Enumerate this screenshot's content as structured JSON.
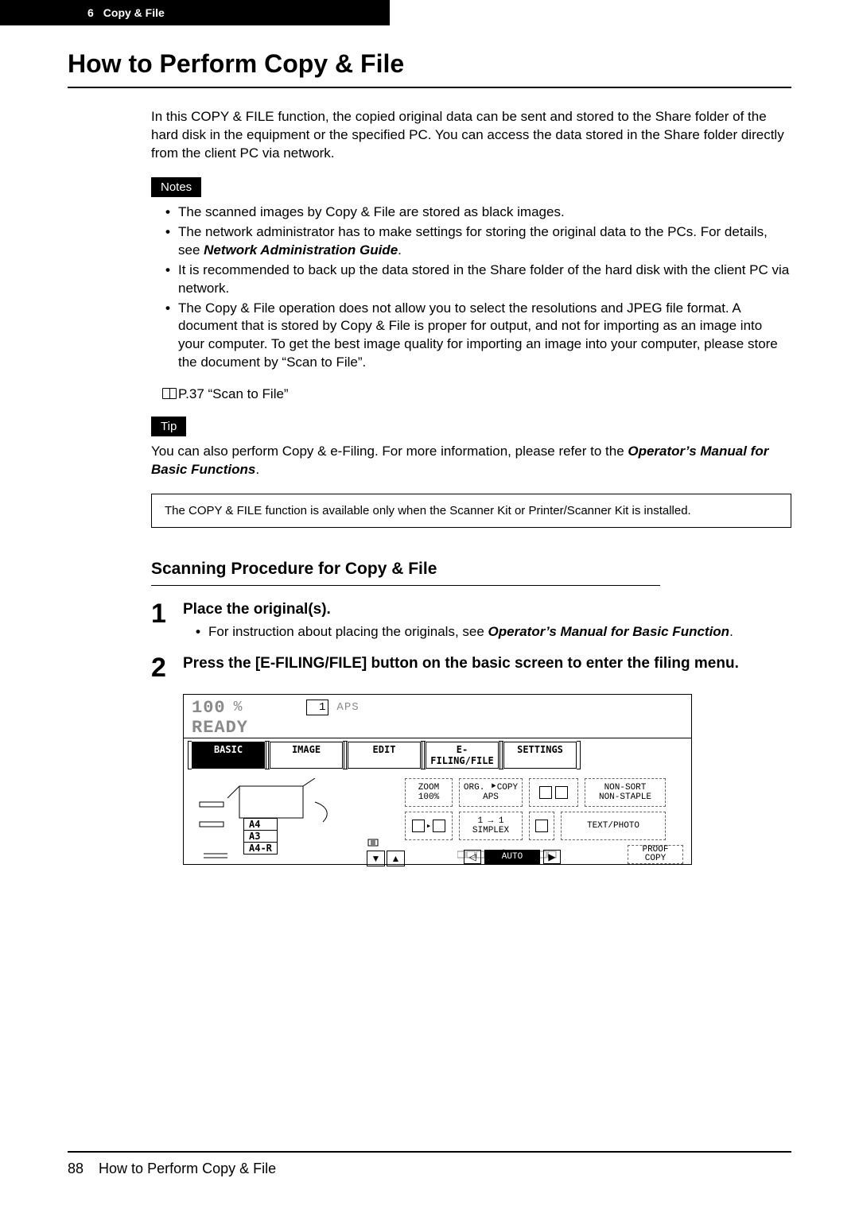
{
  "header": {
    "chapter_num": "6",
    "chapter_title": "Copy & File"
  },
  "main_title": "How to Perform Copy & File",
  "intro": "In this COPY & FILE function, the copied original data can be sent and stored to the Share folder of the hard disk in the equipment or the specified PC. You can access the data stored in the Share folder directly from the client PC via network.",
  "notes_label": "Notes",
  "notes": [
    "The scanned images by Copy & File are stored as black images.",
    "The network administrator has to make settings for storing the original data to the PCs. For details, see ",
    "It is recommended to back up the data stored in the Share folder of the hard disk with the client PC via network.",
    "The Copy & File operation does not allow you to select the resolutions and JPEG file format. A document that is stored by Copy & File is proper for output, and not for importing as an image into your computer.  To get the best image quality for importing an image into your computer, please store the document by “Scan to File”."
  ],
  "notes_bold_ref": "Network Administration Guide",
  "notes_ref_line": "P.37 “Scan to File”",
  "tip_label": "Tip",
  "tip_text_pre": "You can also perform Copy & e-Filing.  For more information, please refer to the ",
  "tip_bold": "Operator’s Manual for Basic Functions",
  "tip_text_post": ".",
  "box_note": "The COPY & FILE function is available only when the Scanner Kit or Printer/Scanner Kit is installed.",
  "proc_title": "Scanning Procedure for Copy & File",
  "steps": {
    "s1_num": "1",
    "s1_title": "Place the original(s).",
    "s1_sub_pre": "For instruction about placing the originals, see ",
    "s1_sub_bold": "Operator’s Manual for Basic Function",
    "s1_sub_post": ".",
    "s2_num": "2",
    "s2_title": "Press the [E-FILING/FILE] button on the basic screen to enter the filing menu."
  },
  "screen": {
    "pct": "100",
    "pct_sym": "%",
    "count": "1",
    "aps": "APS",
    "ready": "READY",
    "tabs": {
      "basic": "BASIC",
      "image": "IMAGE",
      "edit": "EDIT",
      "efiling": "E-FILING/FILE",
      "settings": "SETTINGS"
    },
    "paper": {
      "a4": "A4",
      "a3": "A3",
      "a4r": "A4-R"
    },
    "opts": {
      "zoom": "ZOOM\n100%",
      "orgcopy": "ORG. ⯈COPY\nAPS",
      "nonsort": "NON-SORT\nNON-STAPLE",
      "simplex": "1 → 1\nSIMPLEX",
      "textphoto": "TEXT/PHOTO",
      "auto": "AUTO",
      "proof": "PROOF\nCOPY"
    }
  },
  "footer": {
    "page_num": "88",
    "footer_text": "How to Perform Copy & File"
  }
}
